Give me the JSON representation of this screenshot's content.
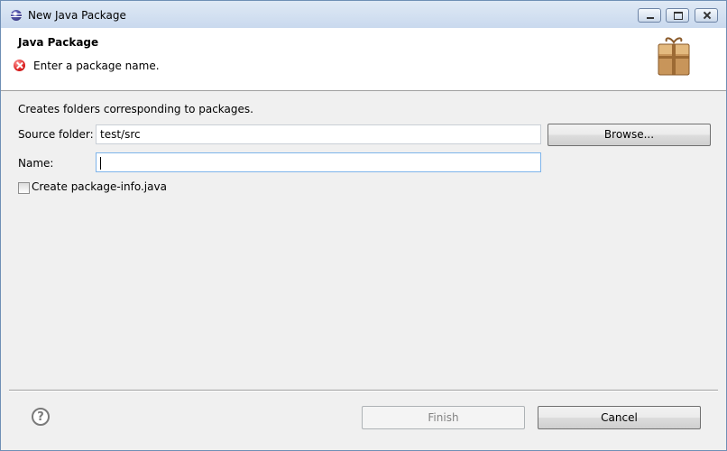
{
  "window": {
    "title": "New Java Package",
    "icon": "eclipse-icon"
  },
  "banner": {
    "title": "Java Package",
    "message": "Enter a package name.",
    "message_icon": "error-icon",
    "image_icon": "package-icon"
  },
  "form": {
    "description": "Creates folders corresponding to packages.",
    "source_folder": {
      "label": "Source folder:",
      "value": "test/src"
    },
    "browse_label": "Browse...",
    "name": {
      "label": "Name:",
      "value": ""
    },
    "create_package_info": {
      "label": "Create package-info.java",
      "checked": false
    }
  },
  "footer": {
    "help_icon": "help-icon",
    "help_glyph": "?",
    "finish_label": "Finish",
    "finish_enabled": false,
    "cancel_label": "Cancel"
  }
}
